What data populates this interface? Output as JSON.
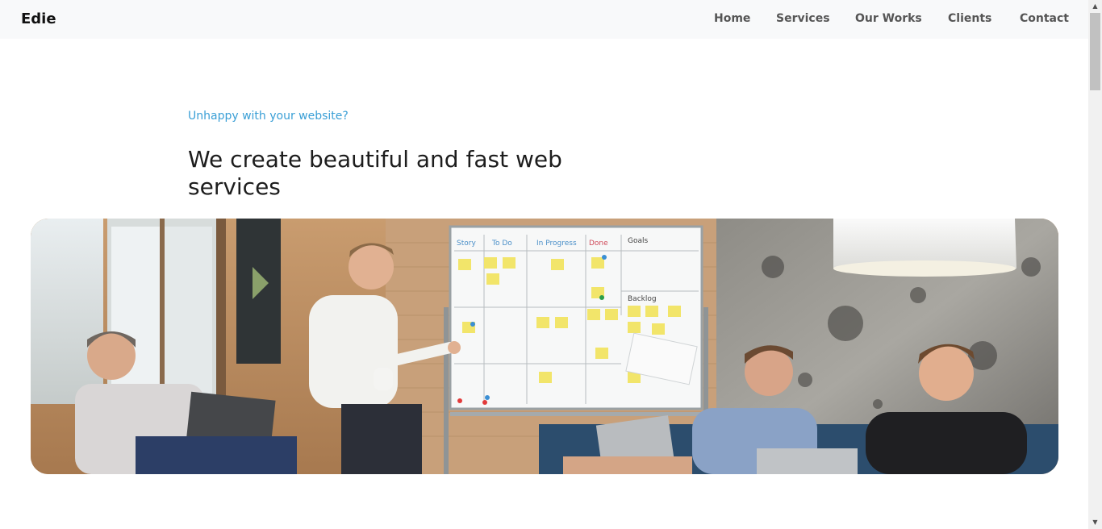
{
  "navbar": {
    "brand": "Edie",
    "items": [
      {
        "label": "Home"
      },
      {
        "label": "Services"
      },
      {
        "label": "Our Works"
      },
      {
        "label": "Clients"
      },
      {
        "label": "Contact"
      }
    ]
  },
  "hero": {
    "eyebrow": "Unhappy with your website?",
    "headline": "We create beautiful and fast web services"
  },
  "whiteboard": {
    "columns": [
      "Story",
      "To Do",
      "In Progress",
      "Done",
      "Goals"
    ],
    "backlog_label": "Backlog"
  },
  "colors": {
    "accent": "#3a9fd6",
    "navbar_bg": "#f8f9fa",
    "nav_text": "#555555",
    "headline_text": "#1d1d1d"
  }
}
